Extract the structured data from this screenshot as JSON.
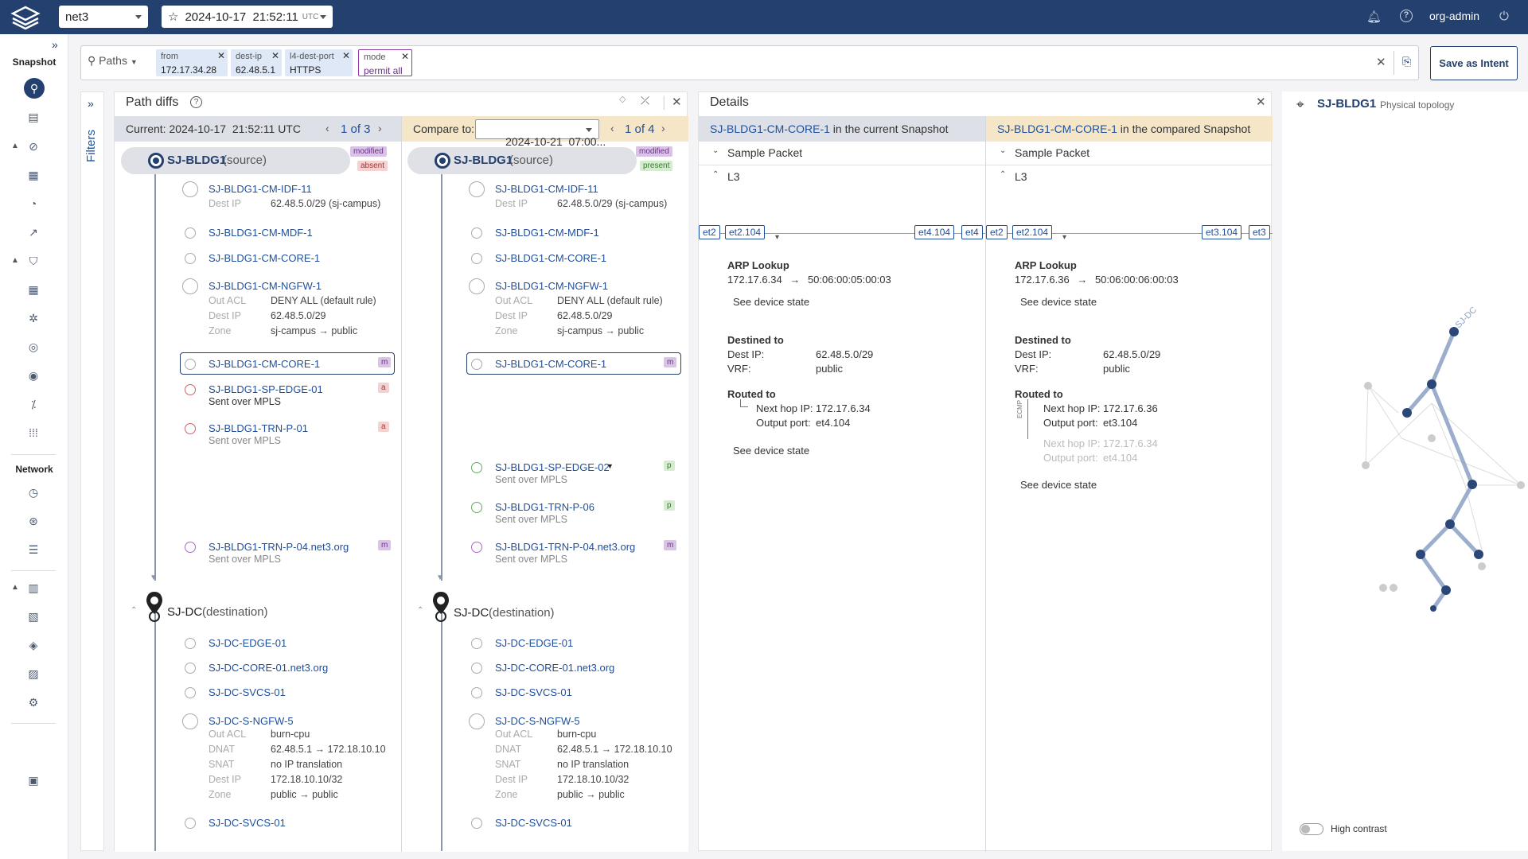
{
  "header": {
    "network": "net3",
    "snapshot_date": "2024-10-17  21:52:11",
    "snapshot_tz": "UTC",
    "user": "org-admin"
  },
  "sidebar": {
    "snapshot_heading": "Snapshot",
    "network_heading": "Network"
  },
  "query": {
    "type": "Paths",
    "chips": [
      {
        "key": "from",
        "value": "172.17.34.28"
      },
      {
        "key": "dest-ip",
        "value": "62.48.5.1"
      },
      {
        "key": "l4-dest-port",
        "value": "HTTPS"
      },
      {
        "key": "mode",
        "value": "permit all"
      }
    ],
    "save_label": "Save as Intent"
  },
  "filters_label": "Filters",
  "path_diffs": {
    "title": "Path diffs",
    "current_label": "Current: 2024-10-17  21:52:11 UTC",
    "current_pager": "1 of 3",
    "compare_label": "Compare to:",
    "compare_date": "2024-10-21  07:00...",
    "compare_pager": "1 of 4",
    "left": {
      "source": "SJ-BLDG1",
      "source_role": "(source)",
      "badge1": "modified",
      "badge2": "absent",
      "hops": [
        {
          "name": "SJ-BLDG1-CM-IDF-11",
          "k1": "Dest IP",
          "v1": "62.48.5.0/29 (sj-campus)"
        },
        {
          "name": "SJ-BLDG1-CM-MDF-1"
        },
        {
          "name": "SJ-BLDG1-CM-CORE-1"
        },
        {
          "name": "SJ-BLDG1-CM-NGFW-1",
          "k1": "Out ACL",
          "v1": "DENY ALL (default rule)",
          "k2": "Dest IP",
          "v2": "62.48.5.0/29",
          "k3": "Zone",
          "v3": "sj-campus → public"
        },
        {
          "name": "SJ-BLDG1-CM-CORE-1",
          "badge": "m"
        },
        {
          "name": "SJ-BLDG1-SP-EDGE-01",
          "sub": "Sent over MPLS",
          "badge": "a"
        },
        {
          "name": "SJ-BLDG1-TRN-P-01",
          "sub": "Sent over MPLS",
          "badge": "a"
        },
        {
          "name": "SJ-BLDG1-TRN-P-04.net3.org",
          "sub": "Sent over MPLS",
          "badge": "m"
        }
      ],
      "dest": "SJ-DC",
      "dest_role": "(destination)",
      "dest_hops": [
        {
          "name": "SJ-DC-EDGE-01"
        },
        {
          "name": "SJ-DC-CORE-01.net3.org"
        },
        {
          "name": "SJ-DC-SVCS-01"
        },
        {
          "name": "SJ-DC-S-NGFW-5",
          "k1": "Out ACL",
          "v1": "burn-cpu",
          "k2": "DNAT",
          "v2": "62.48.5.1 → 172.18.10.10",
          "k3": "SNAT",
          "v3": "no IP translation",
          "k4": "Dest IP",
          "v4": "172.18.10.10/32",
          "k5": "Zone",
          "v5": "public → public"
        },
        {
          "name": "SJ-DC-SVCS-01"
        }
      ]
    },
    "right": {
      "source": "SJ-BLDG1",
      "source_role": "(source)",
      "badge1": "modified",
      "badge2": "present",
      "hops": [
        {
          "name": "SJ-BLDG1-CM-IDF-11",
          "k1": "Dest IP",
          "v1": "62.48.5.0/29 (sj-campus)"
        },
        {
          "name": "SJ-BLDG1-CM-MDF-1"
        },
        {
          "name": "SJ-BLDG1-CM-CORE-1"
        },
        {
          "name": "SJ-BLDG1-CM-NGFW-1",
          "k1": "Out ACL",
          "v1": "DENY ALL (default rule)",
          "k2": "Dest IP",
          "v2": "62.48.5.0/29",
          "k3": "Zone",
          "v3": "sj-campus → public"
        },
        {
          "name": "SJ-BLDG1-CM-CORE-1",
          "badge": "m"
        },
        {
          "name": "SJ-BLDG1-SP-EDGE-02",
          "sub": "Sent over MPLS",
          "badge": "p"
        },
        {
          "name": "SJ-BLDG1-TRN-P-06",
          "sub": "Sent over MPLS",
          "badge": "p"
        },
        {
          "name": "SJ-BLDG1-TRN-P-04.net3.org",
          "sub": "Sent over MPLS",
          "badge": "m"
        }
      ],
      "dest": "SJ-DC",
      "dest_role": "(destination)",
      "dest_hops": [
        {
          "name": "SJ-DC-EDGE-01"
        },
        {
          "name": "SJ-DC-CORE-01.net3.org"
        },
        {
          "name": "SJ-DC-SVCS-01"
        },
        {
          "name": "SJ-DC-S-NGFW-5",
          "k1": "Out ACL",
          "v1": "burn-cpu",
          "k2": "DNAT",
          "v2": "62.48.5.1 → 172.18.10.10",
          "k3": "SNAT",
          "v3": "no IP translation",
          "k4": "Dest IP",
          "v4": "172.18.10.10/32",
          "k5": "Zone",
          "v5": "public → public"
        },
        {
          "name": "SJ-DC-SVCS-01"
        }
      ]
    }
  },
  "details": {
    "title": "Details",
    "left": {
      "device": "SJ-BLDG1-CM-CORE-1",
      "suffix": " in the current Snapshot",
      "sample_packet": "Sample Packet",
      "l3": "L3",
      "ports": [
        "et2",
        "et2.104",
        "et4.104",
        "et4"
      ],
      "arp_title": "ARP Lookup",
      "arp_ip": "172.17.6.34",
      "arp_arrow": "→",
      "arp_mac": "50:06:00:05:00:03",
      "see_state": "See device state",
      "destined_title": "Destined to",
      "dest_ip_label": "Dest IP:",
      "dest_ip": "62.48.5.0/29",
      "vrf_label": "VRF:",
      "vrf": "public",
      "routed_title": "Routed to",
      "next_hop_label": "Next hop IP:",
      "next_hop": "172.17.6.34",
      "out_port_label": "Output port:",
      "out_port": "et4.104"
    },
    "right": {
      "device": "SJ-BLDG1-CM-CORE-1",
      "suffix": " in the compared Snapshot",
      "sample_packet": "Sample Packet",
      "l3": "L3",
      "ports": [
        "et2",
        "et2.104",
        "et3.104",
        "et3"
      ],
      "arp_title": "ARP Lookup",
      "arp_ip": "172.17.6.36",
      "arp_arrow": "→",
      "arp_mac": "50:06:00:06:00:03",
      "see_state": "See device state",
      "destined_title": "Destined to",
      "dest_ip_label": "Dest IP:",
      "dest_ip": "62.48.5.0/29",
      "vrf_label": "VRF:",
      "vrf": "public",
      "routed_title": "Routed to",
      "ecmp": "ECMP",
      "next_hop_label": "Next hop IP:",
      "next_hop": "172.17.6.36",
      "out_port_label": "Output port:",
      "out_port": "et3.104",
      "next_hop2": "172.17.6.34",
      "out_port2": "et4.104"
    }
  },
  "topology": {
    "site": "SJ-BLDG1",
    "subtitle": "Physical topology",
    "node_label": "SJ-DC",
    "high_contrast": "High contrast"
  }
}
